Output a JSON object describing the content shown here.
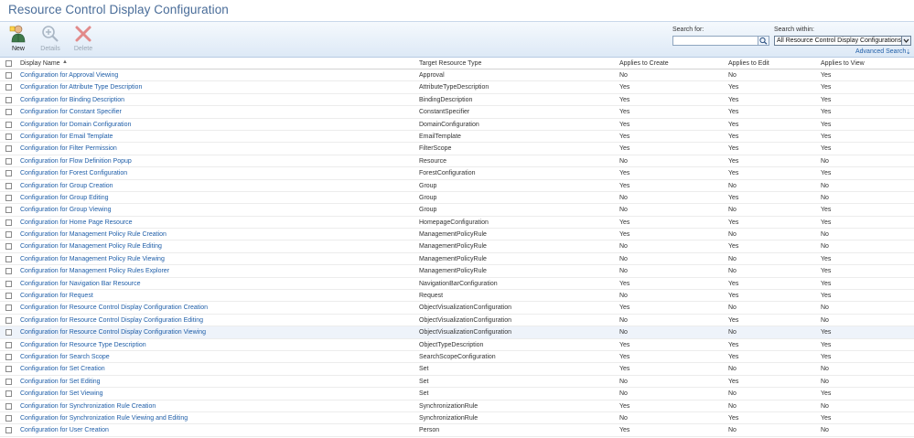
{
  "page": {
    "title": "Resource Control Display Configuration"
  },
  "toolbar": {
    "new_label": "New",
    "details_label": "Details",
    "delete_label": "Delete"
  },
  "search": {
    "for_label": "Search for:",
    "for_value": "",
    "within_label": "Search within:",
    "within_value": "All Resource Control Display Configurations",
    "advanced_label": "Advanced Search"
  },
  "grid": {
    "columns": [
      "Display Name",
      "Target Resource Type",
      "Applies to Create",
      "Applies to Edit",
      "Applies to View"
    ],
    "rows": [
      [
        "Configuration for Approval Viewing",
        "Approval",
        "No",
        "No",
        "Yes"
      ],
      [
        "Configuration for Attribute Type Description",
        "AttributeTypeDescription",
        "Yes",
        "Yes",
        "Yes"
      ],
      [
        "Configuration for Binding Description",
        "BindingDescription",
        "Yes",
        "Yes",
        "Yes"
      ],
      [
        "Configuration for Constant Specifier",
        "ConstantSpecifier",
        "Yes",
        "Yes",
        "Yes"
      ],
      [
        "Configuration for Domain Configuration",
        "DomainConfiguration",
        "Yes",
        "Yes",
        "Yes"
      ],
      [
        "Configuration for Email Template",
        "EmailTemplate",
        "Yes",
        "Yes",
        "Yes"
      ],
      [
        "Configuration for Filter Permission",
        "FilterScope",
        "Yes",
        "Yes",
        "Yes"
      ],
      [
        "Configuration for Flow Definition Popup",
        "Resource",
        "No",
        "Yes",
        "No"
      ],
      [
        "Configuration for Forest Configuration",
        "ForestConfiguration",
        "Yes",
        "Yes",
        "Yes"
      ],
      [
        "Configuration for Group Creation",
        "Group",
        "Yes",
        "No",
        "No"
      ],
      [
        "Configuration for Group Editing",
        "Group",
        "No",
        "Yes",
        "No"
      ],
      [
        "Configuration for Group Viewing",
        "Group",
        "No",
        "No",
        "Yes"
      ],
      [
        "Configuration for Home Page Resource",
        "HomepageConfiguration",
        "Yes",
        "Yes",
        "Yes"
      ],
      [
        "Configuration for Management Policy Rule Creation",
        "ManagementPolicyRule",
        "Yes",
        "No",
        "No"
      ],
      [
        "Configuration for Management Policy Rule Editing",
        "ManagementPolicyRule",
        "No",
        "Yes",
        "No"
      ],
      [
        "Configuration for Management Policy Rule Viewing",
        "ManagementPolicyRule",
        "No",
        "No",
        "Yes"
      ],
      [
        "Configuration for Management Policy Rules Explorer",
        "ManagementPolicyRule",
        "No",
        "No",
        "Yes"
      ],
      [
        "Configuration for Navigation Bar Resource",
        "NavigationBarConfiguration",
        "Yes",
        "Yes",
        "Yes"
      ],
      [
        "Configuration for Request",
        "Request",
        "No",
        "Yes",
        "Yes"
      ],
      [
        "Configuration for Resource Control Display Configuration Creation",
        "ObjectVisualizationConfiguration",
        "Yes",
        "No",
        "No"
      ],
      [
        "Configuration for Resource Control Display Configuration Editing",
        "ObjectVisualizationConfiguration",
        "No",
        "Yes",
        "No"
      ],
      [
        "Configuration for Resource Control Display Configuration Viewing",
        "ObjectVisualizationConfiguration",
        "No",
        "No",
        "Yes"
      ],
      [
        "Configuration for Resource Type Description",
        "ObjectTypeDescription",
        "Yes",
        "Yes",
        "Yes"
      ],
      [
        "Configuration for Search Scope",
        "SearchScopeConfiguration",
        "Yes",
        "Yes",
        "Yes"
      ],
      [
        "Configuration for Set Creation",
        "Set",
        "Yes",
        "No",
        "No"
      ],
      [
        "Configuration for Set Editing",
        "Set",
        "No",
        "Yes",
        "No"
      ],
      [
        "Configuration for Set Viewing",
        "Set",
        "No",
        "No",
        "Yes"
      ],
      [
        "Configuration for Synchronization Rule Creation",
        "SynchronizationRule",
        "Yes",
        "No",
        "No"
      ],
      [
        "Configuration for Synchronization Rule Viewing and Editing",
        "SynchronizationRule",
        "No",
        "Yes",
        "Yes"
      ],
      [
        "Configuration for User Creation",
        "Person",
        "Yes",
        "No",
        "No"
      ]
    ],
    "selected_row": 21
  },
  "colors": {
    "title": "#4a6d99",
    "link": "#1f5ea8",
    "toolbar_bg": "#dde9f6"
  },
  "icons": {
    "new": "user-add-icon",
    "details": "magnify-plus-icon",
    "delete": "red-x-icon",
    "search": "magnifier-icon",
    "sort": "sort-ascending-icon"
  }
}
